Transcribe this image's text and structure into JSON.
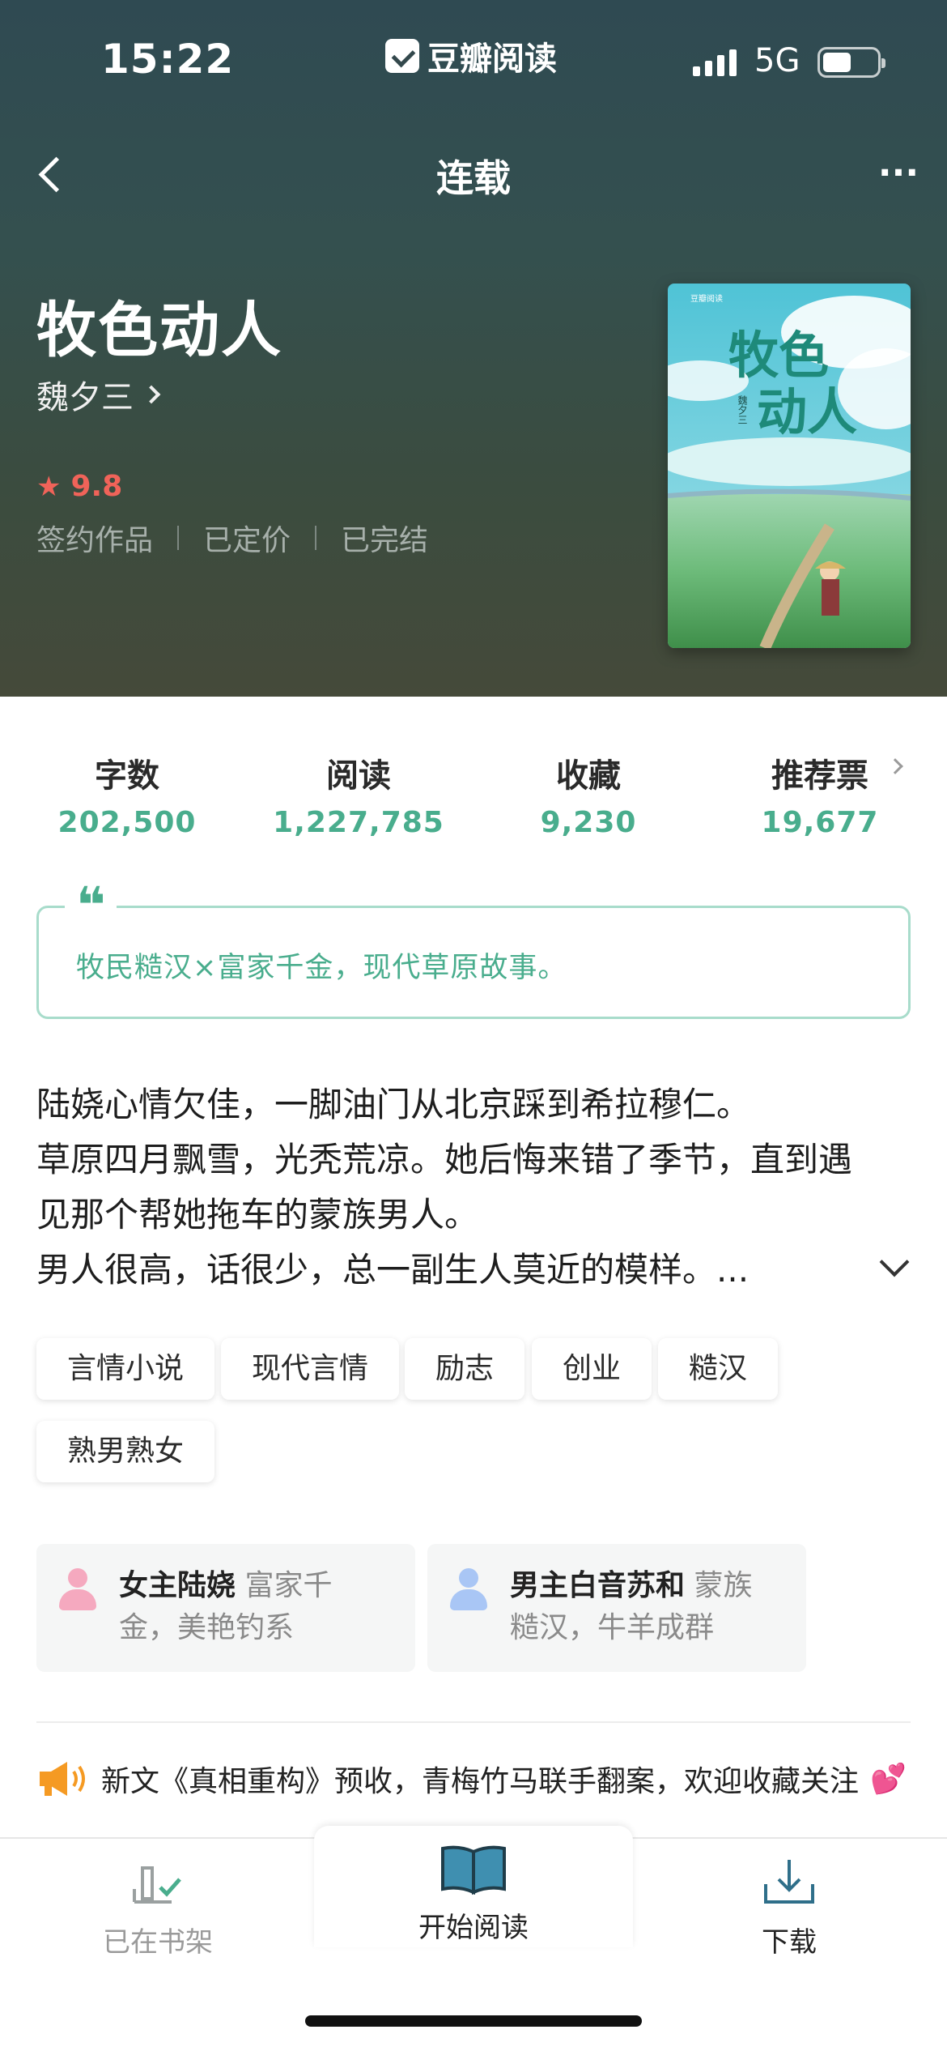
{
  "status_bar": {
    "time": "15:22",
    "app_badge": "豆瓣阅读",
    "network": "5G"
  },
  "nav": {
    "title": "连载",
    "back_icon": "chevron-left-icon",
    "more_label": "···"
  },
  "book": {
    "title": "牧色动人",
    "author": "魏夕三",
    "rating": "9.8",
    "meta": [
      "签约作品",
      "已定价",
      "已完结"
    ],
    "cover": {
      "publisher": "豆瓣阅读",
      "title_line1": "牧色",
      "title_line2": "动人",
      "author": "魏夕三"
    }
  },
  "stats": [
    {
      "label": "字数",
      "value": "202,500"
    },
    {
      "label": "阅读",
      "value": "1,227,785"
    },
    {
      "label": "收藏",
      "value": "9,230"
    },
    {
      "label": "推荐票",
      "value": "19,677"
    }
  ],
  "quote": {
    "mark": "❝",
    "text": "牧民糙汉×富家千金，现代草原故事。"
  },
  "synopsis": {
    "lines": [
      "陆娆心情欠佳，一脚油门从北京踩到希拉穆仁。",
      "草原四月飘雪，光秃荒凉。她后悔来错了季节，直到遇",
      "见那个帮她拖车的蒙族男人。",
      "男人很高，话很少，总一副生人莫近的模样。..."
    ]
  },
  "tags": [
    "言情小说",
    "现代言情",
    "励志",
    "创业",
    "糙汉",
    "熟男熟女"
  ],
  "characters": [
    {
      "name": "女主陆娆",
      "line1": " 富家千",
      "line2": "金，美艳钓系",
      "color": "#f5a9bf"
    },
    {
      "name": "男主白音苏和",
      "line1": " 蒙族",
      "line2": "糙汉，牛羊成群",
      "color": "#a9c6f5"
    }
  ],
  "announcement": {
    "text": "新文《真相重构》预收，青梅竹马联手翻案，欢迎收藏关注",
    "heart": "💕"
  },
  "bottom_bar": {
    "shelf_label": "已在书架",
    "read_label": "开始阅读",
    "download_label": "下载"
  },
  "colors": {
    "accent_green": "#49ad8d",
    "rating_red": "#f06359",
    "megaphone_orange": "#f59a23"
  }
}
